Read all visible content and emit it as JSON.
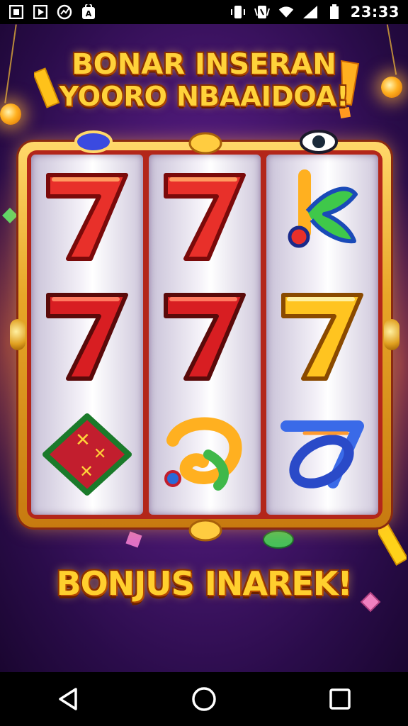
{
  "status_bar": {
    "time": "23:33",
    "left_icons": [
      "image-icon",
      "play-icon",
      "chart-icon",
      "shop-icon"
    ],
    "right_icons": [
      "vibrate-icon",
      "nfc-icon",
      "wifi-icon",
      "signal-icon",
      "battery-icon"
    ]
  },
  "game": {
    "title_line1": "BONAR INSERAN",
    "title_line2": "YOORO NBAAIDOA!",
    "bonus_text": "BONJUS INAREK!",
    "reels": [
      [
        "seven-red",
        "seven-red",
        "diamond-badge"
      ],
      [
        "seven-red",
        "seven-red",
        "swirl-symbol"
      ],
      [
        "k-symbol",
        "seven-gold",
        "blue-swirl"
      ]
    ],
    "colors": {
      "gold": "#ffd23a",
      "frame_red": "#b3261a",
      "bg_purple": "#4a1873"
    }
  },
  "nav_bar": {
    "buttons": [
      "back-icon",
      "home-icon",
      "recents-icon"
    ]
  }
}
